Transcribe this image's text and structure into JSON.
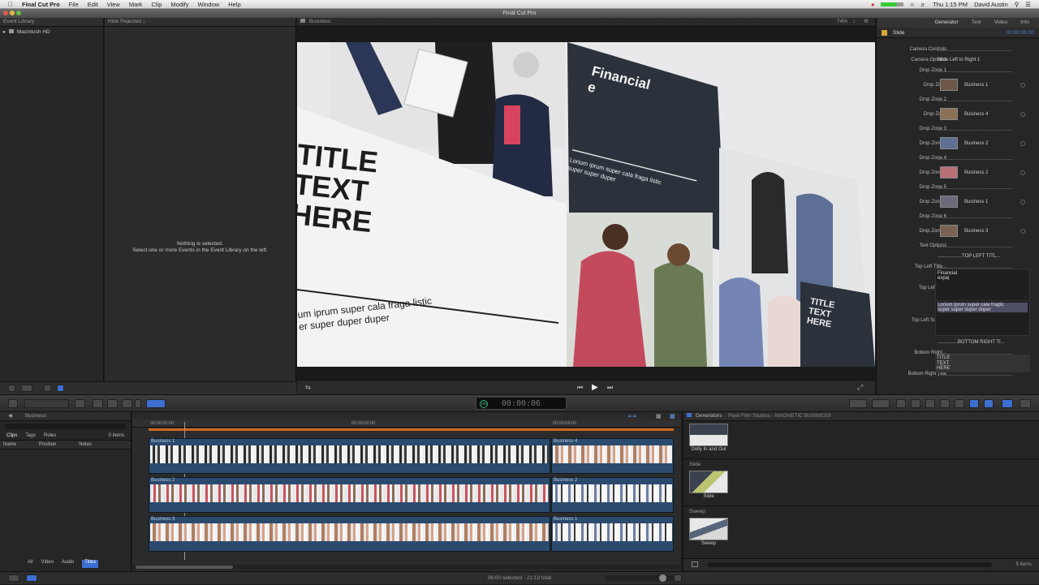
{
  "menubar": {
    "app_name": "Final Cut Pro",
    "items": [
      "File",
      "Edit",
      "View",
      "Mark",
      "Clip",
      "Modify",
      "Window",
      "Help"
    ],
    "clock": "Thu 1:15 PM",
    "user": "David Austin"
  },
  "window": {
    "title": "Final Cut Pro"
  },
  "library": {
    "header": "Event Library",
    "disk": "Macintosh HD"
  },
  "browser": {
    "filter": "Hide Rejected",
    "empty_line1": "Nothing is selected.",
    "empty_line2": "Select one or more Events in the Event Library on the left."
  },
  "viewer": {
    "title": "Business",
    "zoom": "74%",
    "scene": {
      "title_text": [
        "TITLE",
        "TEXT",
        "HERE"
      ],
      "subtitle": [
        "um iprum super cala fraga listic",
        "er super duper duper"
      ],
      "card_title": [
        "Financial",
        "e"
      ],
      "card_body": [
        "Lorium iprum super cala fraga listic",
        "super super duper"
      ],
      "small_title": [
        "TITLE",
        "TEXT",
        "HERE"
      ]
    }
  },
  "inspector": {
    "tabs": [
      "Generator",
      "Text",
      "Video",
      "Info"
    ],
    "generator_name": "Slide",
    "timecode": "00:00:06:00",
    "rows": [
      {
        "label": "Camera Controls",
        "value": ""
      },
      {
        "label": "Camera Options",
        "value": "Slide Left to Right 1"
      },
      {
        "label": "Drop Zone 1",
        "value": ""
      },
      {
        "label": "Drop Zone",
        "value": "Business 1",
        "thumb": "#6d5748"
      },
      {
        "label": "Drop Zone 2",
        "value": ""
      },
      {
        "label": "Drop Zone",
        "value": "Business 4",
        "thumb": "#8a7055"
      },
      {
        "label": "Drop Zone 3",
        "value": ""
      },
      {
        "label": "Drop Zone 3",
        "value": "Business 2",
        "thumb": "#5e6f93"
      },
      {
        "label": "Drop Zone 4",
        "value": ""
      },
      {
        "label": "Drop Zone 4",
        "value": "Business 2",
        "thumb": "#b86f77"
      },
      {
        "label": "Drop Zone 5",
        "value": ""
      },
      {
        "label": "Drop Zone 5",
        "value": "Business 1",
        "thumb": "#6a6a7a"
      },
      {
        "label": "Drop Zone 6",
        "value": ""
      },
      {
        "label": "Drop Zone 6",
        "value": "Business 3",
        "thumb": "#7a6352"
      },
      {
        "label": "Text Options",
        "value": ""
      },
      {
        "label": "",
        "value": "..................TOP LEFT TITL..."
      },
      {
        "label": "Top Left Title...",
        "value": ""
      },
      {
        "label": "Top Left Title",
        "value": ""
      },
      {
        "label": "Top Left Subtitle",
        "value": ""
      },
      {
        "label": "",
        "value": "...............BOTTOM RIGHT TI..."
      },
      {
        "label": "Bottom Right...",
        "value": ""
      },
      {
        "label": "Bottom Right Title",
        "value": ""
      }
    ],
    "top_left_title_text": [
      "Financial",
      "expa|"
    ],
    "top_left_subtitle_text": [
      "Lorium iprum super cala fraglic",
      "super super duper duper"
    ],
    "bottom_right_title_text": [
      "TITLE",
      "TEXT",
      "HERE"
    ]
  },
  "timecode_display": "00:00:06",
  "timecode_badge": "100",
  "index": {
    "project": "Business",
    "tabs": [
      "Clips",
      "Tags",
      "Roles"
    ],
    "count": "0 items",
    "columns": [
      "Name",
      "Position",
      "Notes"
    ],
    "bottom_tabs": [
      "All",
      "Video",
      "Audio",
      "Titles"
    ]
  },
  "timeline": {
    "ruler": [
      "00:00:00:00",
      "00:00:02:00",
      "00:00:04:00"
    ],
    "tracks": [
      {
        "left_clip": "Business 1",
        "right_clip": "Business 4"
      },
      {
        "left_clip": "Business 2",
        "right_clip": "Business 2"
      },
      {
        "left_clip": "Business 3",
        "right_clip": "Business 1"
      }
    ]
  },
  "generators": {
    "header": "Generators",
    "path": "Pixel Film Studios - MAGNETIC BUSINESS",
    "items": [
      {
        "section": "",
        "label": "Dolly In and Out"
      },
      {
        "section": "Slide",
        "label": "Slide"
      },
      {
        "section": "Sweep",
        "label": "Sweep"
      }
    ],
    "count": "5 items"
  },
  "status": {
    "text": "06:00 selected - 21:13 total"
  }
}
